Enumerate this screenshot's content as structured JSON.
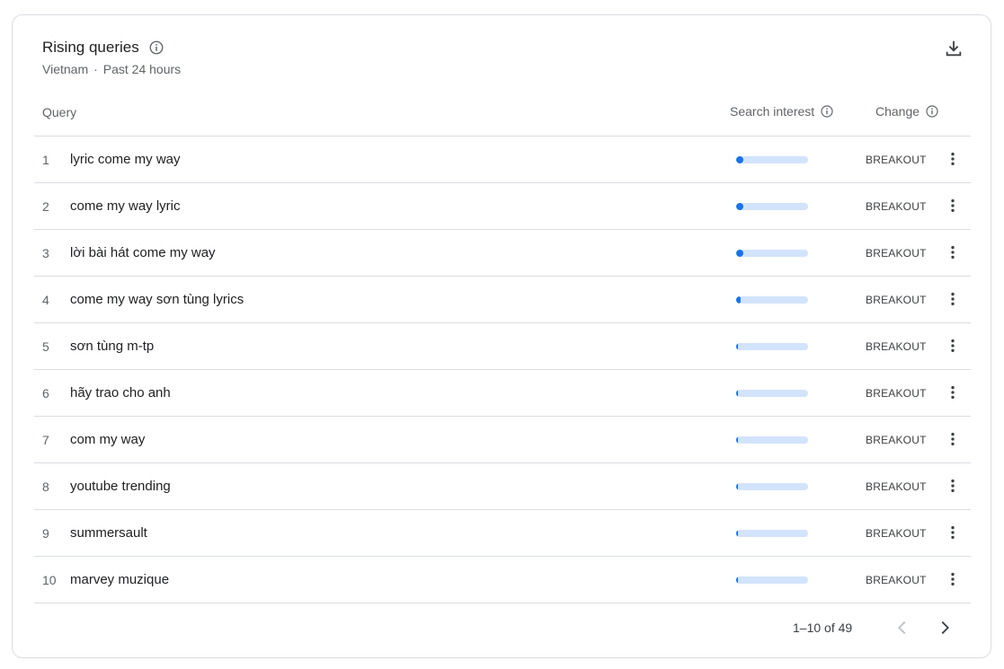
{
  "card": {
    "title": "Rising queries",
    "location": "Vietnam",
    "separator": "·",
    "timeframe": "Past 24 hours"
  },
  "table": {
    "columns": {
      "query": "Query",
      "search_interest": "Search interest",
      "change": "Change"
    },
    "rows": [
      {
        "rank": "1",
        "query": "lyric come my way",
        "interest_fraction": 0.1,
        "change": "BREAKOUT"
      },
      {
        "rank": "2",
        "query": "come my way lyric",
        "interest_fraction": 0.1,
        "change": "BREAKOUT"
      },
      {
        "rank": "3",
        "query": "lời bài hát come my way",
        "interest_fraction": 0.1,
        "change": "BREAKOUT"
      },
      {
        "rank": "4",
        "query": "come my way sơn tùng lyrics",
        "interest_fraction": 0.06,
        "change": "BREAKOUT"
      },
      {
        "rank": "5",
        "query": "sơn tùng m-tp",
        "interest_fraction": 0.03,
        "change": "BREAKOUT"
      },
      {
        "rank": "6",
        "query": "hãy trao cho anh",
        "interest_fraction": 0.02,
        "change": "BREAKOUT"
      },
      {
        "rank": "7",
        "query": "com my way",
        "interest_fraction": 0.02,
        "change": "BREAKOUT"
      },
      {
        "rank": "8",
        "query": "youtube trending",
        "interest_fraction": 0.02,
        "change": "BREAKOUT"
      },
      {
        "rank": "9",
        "query": "summersault",
        "interest_fraction": 0.02,
        "change": "BREAKOUT"
      },
      {
        "rank": "10",
        "query": "marvey muzique",
        "interest_fraction": 0.02,
        "change": "BREAKOUT"
      }
    ]
  },
  "pagination": {
    "label": "1–10 of 49"
  },
  "icons": {
    "info": "info-icon",
    "download": "download-icon",
    "more": "more-vert-icon",
    "prev": "chevron-left-icon",
    "next": "chevron-right-icon"
  },
  "colors": {
    "bar_fill": "#1a73e8",
    "bar_track": "#d2e3fc",
    "border": "#dadce0"
  }
}
